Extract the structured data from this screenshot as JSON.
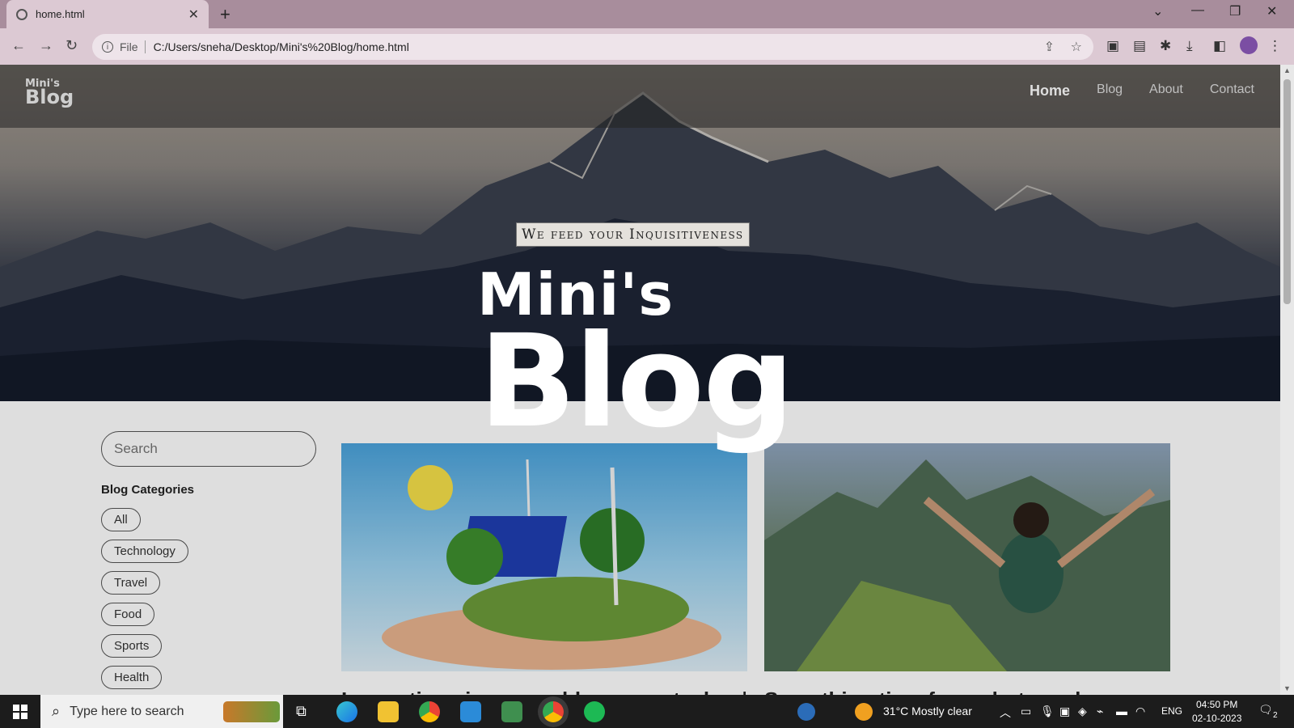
{
  "browser": {
    "tab_title": "home.html",
    "url_scheme_label": "File",
    "url": "C:/Users/sneha/Desktop/Mini's%20Blog/home.html"
  },
  "site": {
    "logo_small": "Mini's",
    "logo_big": "Blog",
    "nav": [
      "Home",
      "Blog",
      "About",
      "Contact"
    ],
    "tagline": "We feed your Inquisitiveness",
    "hero_title_1": "Mini's",
    "hero_title_2": "Blog",
    "search_placeholder": "Search",
    "categories_title": "Blog Categories",
    "categories": [
      "All",
      "Technology",
      "Travel",
      "Food",
      "Sports",
      "Health"
    ],
    "posts": [
      {
        "title": "Innovations in renewable energy technology"
      },
      {
        "title": "Something time for a photo and"
      }
    ]
  },
  "taskbar": {
    "search_placeholder": "Type here to search",
    "weather": "31°C  Mostly clear",
    "language": "ENG",
    "time": "04:50 PM",
    "date": "02-10-2023",
    "notification_count": "2"
  },
  "colors": {
    "tab_bar": "#a88d9c",
    "toolbar": "#dcc9d3",
    "taskbar": "#1c1c1c"
  }
}
